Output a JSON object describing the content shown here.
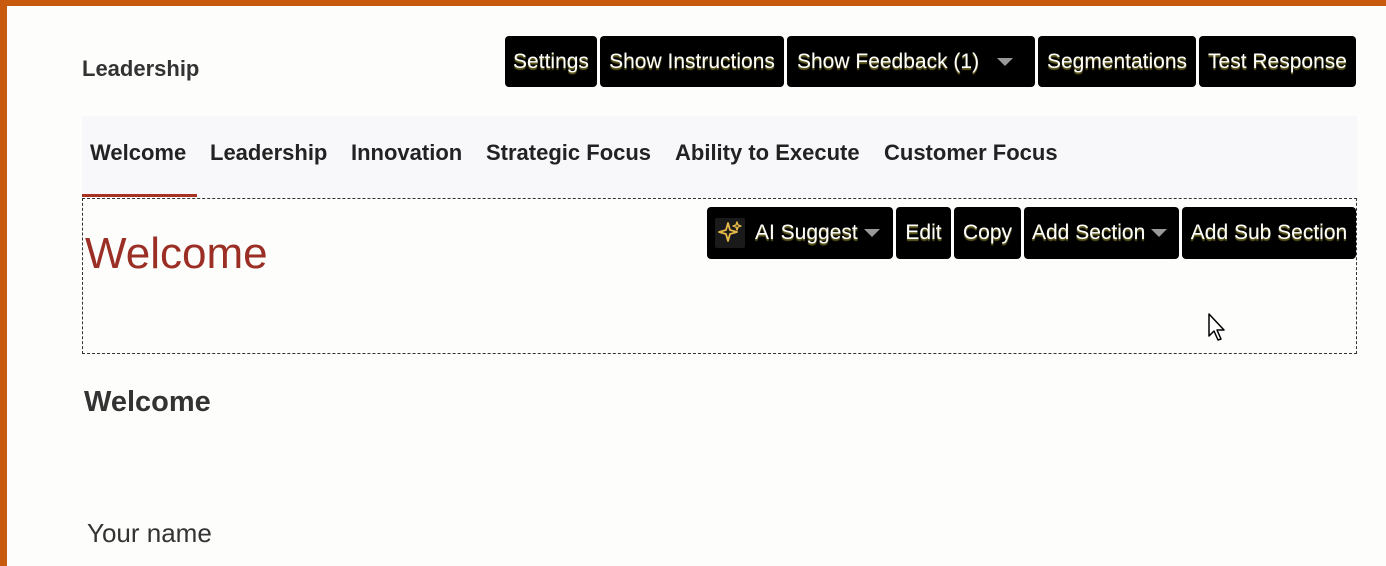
{
  "page": {
    "title": "Leadership"
  },
  "toolbar": {
    "settings": "Settings",
    "show_instructions": "Show Instructions",
    "show_feedback": "Show Feedback (1)",
    "segmentations": "Segmentations",
    "test_response": "Test Response"
  },
  "tabs": [
    {
      "label": "Welcome",
      "active": true
    },
    {
      "label": "Leadership"
    },
    {
      "label": "Innovation"
    },
    {
      "label": "Strategic Focus"
    },
    {
      "label": "Ability to Execute"
    },
    {
      "label": "Customer Focus"
    }
  ],
  "section": {
    "heading": "Welcome",
    "toolbar": {
      "ai_suggest": "AI Suggest",
      "edit": "Edit",
      "copy": "Copy",
      "add_section": "Add Section",
      "add_sub_section": "Add Sub Section"
    }
  },
  "content": {
    "heading": "Welcome",
    "field_label": "Your name"
  },
  "colors": {
    "accent": "#9b2f25",
    "border_orange": "#c85a0e",
    "sparkle": "#e8b94a"
  }
}
